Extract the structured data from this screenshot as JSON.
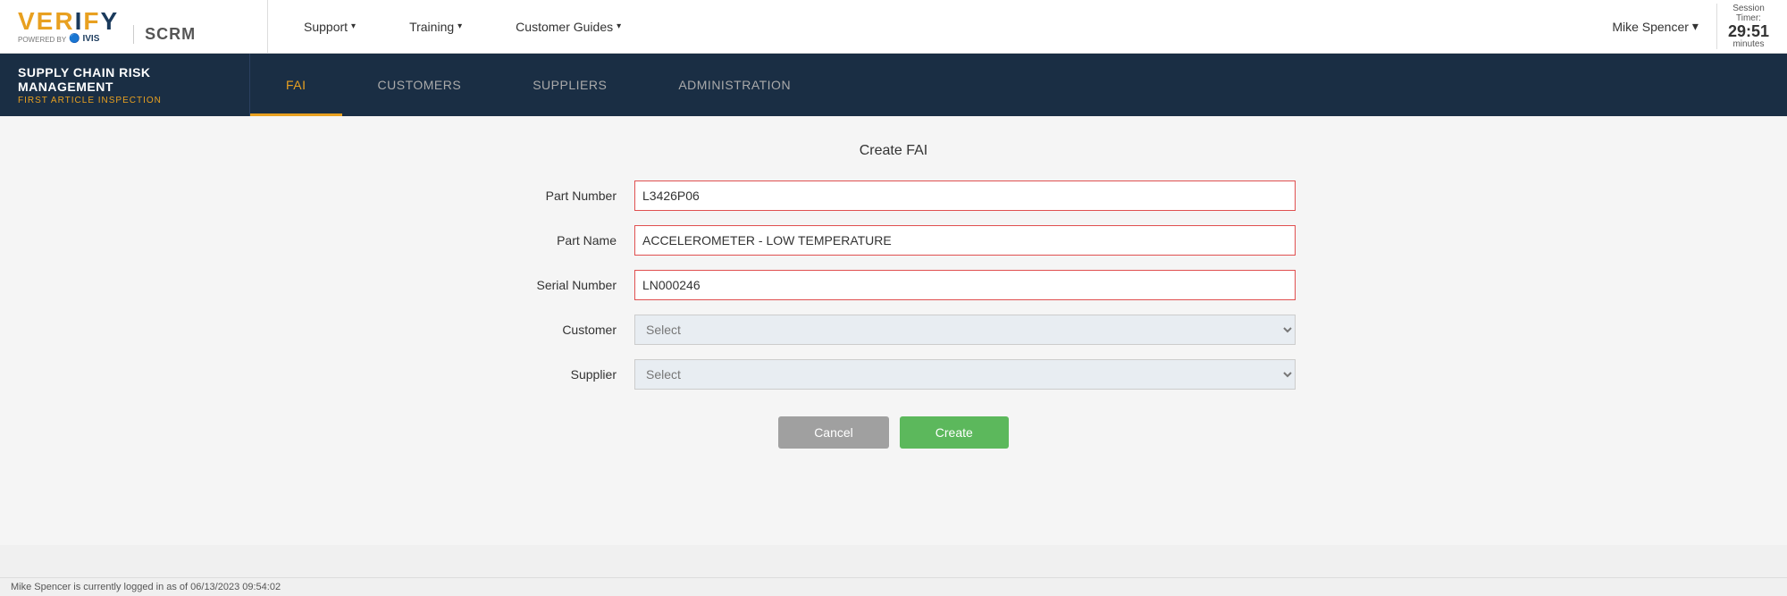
{
  "topNav": {
    "logo": {
      "verify": "VERIFY",
      "powered_by": "POWERED BY",
      "ivis": "IVIS",
      "scrm": "SCRM"
    },
    "links": [
      {
        "label": "Support",
        "hasDropdown": true
      },
      {
        "label": "Training",
        "hasDropdown": true
      },
      {
        "label": "Customer Guides",
        "hasDropdown": true
      }
    ],
    "user": {
      "name": "Mike Spencer",
      "hasDropdown": true
    },
    "session": {
      "label": "Session Timer:",
      "time": "29:51",
      "unit": "minutes"
    }
  },
  "subNav": {
    "title": "SUPPLY CHAIN RISK MANAGEMENT",
    "subtitle": "FIRST ARTICLE INSPECTION",
    "items": [
      {
        "label": "FAI",
        "active": true
      },
      {
        "label": "CUSTOMERS",
        "active": false
      },
      {
        "label": "SUPPLIERS",
        "active": false
      },
      {
        "label": "ADMINISTRATION",
        "active": false
      }
    ]
  },
  "form": {
    "title": "Create FAI",
    "fields": {
      "partNumber": {
        "label": "Part Number",
        "value": "L3426P06",
        "placeholder": ""
      },
      "partName": {
        "label": "Part Name",
        "value": "ACCELEROMETER - LOW TEMPERATURE",
        "placeholder": ""
      },
      "serialNumber": {
        "label": "Serial Number",
        "value": "LN000246",
        "placeholder": ""
      },
      "customer": {
        "label": "Customer",
        "value": "Select",
        "placeholder": "Select"
      },
      "supplier": {
        "label": "Supplier",
        "value": "Select",
        "placeholder": "Select"
      }
    },
    "buttons": {
      "cancel": "Cancel",
      "create": "Create"
    }
  },
  "footer": {
    "status": "Mike Spencer is currently logged in as of 06/13/2023 09:54:02"
  }
}
